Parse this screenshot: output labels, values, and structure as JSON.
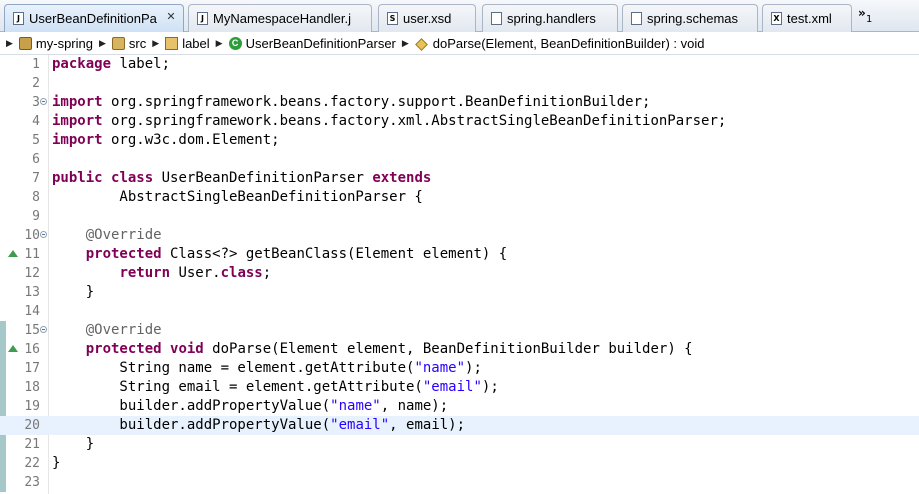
{
  "tabs": [
    {
      "label": "UserBeanDefinitionPa",
      "icon": "J",
      "active": true,
      "closable": true
    },
    {
      "label": "MyNamespaceHandler.j",
      "icon": "J"
    },
    {
      "label": "user.xsd",
      "icon": "S"
    },
    {
      "label": "spring.handlers",
      "icon": ""
    },
    {
      "label": "spring.schemas",
      "icon": ""
    },
    {
      "label": "test.xml",
      "icon": "X"
    }
  ],
  "tab_overflow": {
    "chevron": "»",
    "count": "1"
  },
  "breadcrumb": {
    "project": "my-spring",
    "folder": "src",
    "package": "label",
    "class": "UserBeanDefinitionParser",
    "method": "doParse(Element, BeanDefinitionBuilder) : void"
  },
  "editor": {
    "current_line": 20,
    "colors": {
      "keyword": "#7f0055",
      "string": "#2a00ff",
      "annotation": "#646464",
      "current_line_bg": "#e8f2fe"
    },
    "lines": [
      {
        "n": "1",
        "tokens": [
          [
            "kw",
            "package"
          ],
          [
            "t",
            " label;"
          ]
        ]
      },
      {
        "n": "2",
        "tokens": []
      },
      {
        "n": "3",
        "fold": true,
        "tokens": [
          [
            "kw",
            "import"
          ],
          [
            "t",
            " org.springframework.beans.factory.support.BeanDefinitionBuilder;"
          ]
        ]
      },
      {
        "n": "4",
        "tokens": [
          [
            "kw",
            "import"
          ],
          [
            "t",
            " org.springframework.beans.factory.xml.AbstractSingleBeanDefinitionParser;"
          ]
        ]
      },
      {
        "n": "5",
        "tokens": [
          [
            "kw",
            "import"
          ],
          [
            "t",
            " org.w3c.dom.Element;"
          ]
        ]
      },
      {
        "n": "6",
        "tokens": []
      },
      {
        "n": "7",
        "tokens": [
          [
            "kw",
            "public"
          ],
          [
            "t",
            " "
          ],
          [
            "kw",
            "class"
          ],
          [
            "t",
            " UserBeanDefinitionParser "
          ],
          [
            "kw",
            "extends"
          ]
        ]
      },
      {
        "n": "8",
        "tokens": [
          [
            "t",
            "        AbstractSingleBeanDefinitionParser {"
          ]
        ]
      },
      {
        "n": "9",
        "tokens": []
      },
      {
        "n": "10",
        "fold": true,
        "tokens": [
          [
            "ann",
            "    @Override"
          ]
        ]
      },
      {
        "n": "11",
        "override": true,
        "tokens": [
          [
            "t",
            "    "
          ],
          [
            "kw",
            "protected"
          ],
          [
            "t",
            " Class<?> getBeanClass(Element element) {"
          ]
        ]
      },
      {
        "n": "12",
        "tokens": [
          [
            "t",
            "        "
          ],
          [
            "kw",
            "return"
          ],
          [
            "t",
            " User."
          ],
          [
            "kw",
            "class"
          ],
          [
            "t",
            ";"
          ]
        ]
      },
      {
        "n": "13",
        "tokens": [
          [
            "t",
            "    }"
          ]
        ]
      },
      {
        "n": "14",
        "tokens": []
      },
      {
        "n": "15",
        "fold": true,
        "tokens": [
          [
            "ann",
            "    @Override"
          ]
        ]
      },
      {
        "n": "16",
        "override": true,
        "tokens": [
          [
            "t",
            "    "
          ],
          [
            "kw",
            "protected"
          ],
          [
            "t",
            " "
          ],
          [
            "kw",
            "void"
          ],
          [
            "t",
            " doParse(Element element, BeanDefinitionBuilder builder) {"
          ]
        ]
      },
      {
        "n": "17",
        "tokens": [
          [
            "t",
            "        String name = element.getAttribute("
          ],
          [
            "str",
            "\"name\""
          ],
          [
            "t",
            ");"
          ]
        ]
      },
      {
        "n": "18",
        "tokens": [
          [
            "t",
            "        String email = element.getAttribute("
          ],
          [
            "str",
            "\"email\""
          ],
          [
            "t",
            ");"
          ]
        ]
      },
      {
        "n": "19",
        "tokens": [
          [
            "t",
            "        builder.addPropertyValue("
          ],
          [
            "str",
            "\"name\""
          ],
          [
            "t",
            ", name);"
          ]
        ]
      },
      {
        "n": "20",
        "tokens": [
          [
            "t",
            "        builder.addPropertyValue("
          ],
          [
            "str",
            "\"email\""
          ],
          [
            "t",
            ", email);"
          ]
        ]
      },
      {
        "n": "21",
        "tokens": [
          [
            "t",
            "    }"
          ]
        ]
      },
      {
        "n": "22",
        "tokens": [
          [
            "t",
            "}"
          ]
        ]
      },
      {
        "n": "23",
        "tokens": []
      }
    ]
  }
}
